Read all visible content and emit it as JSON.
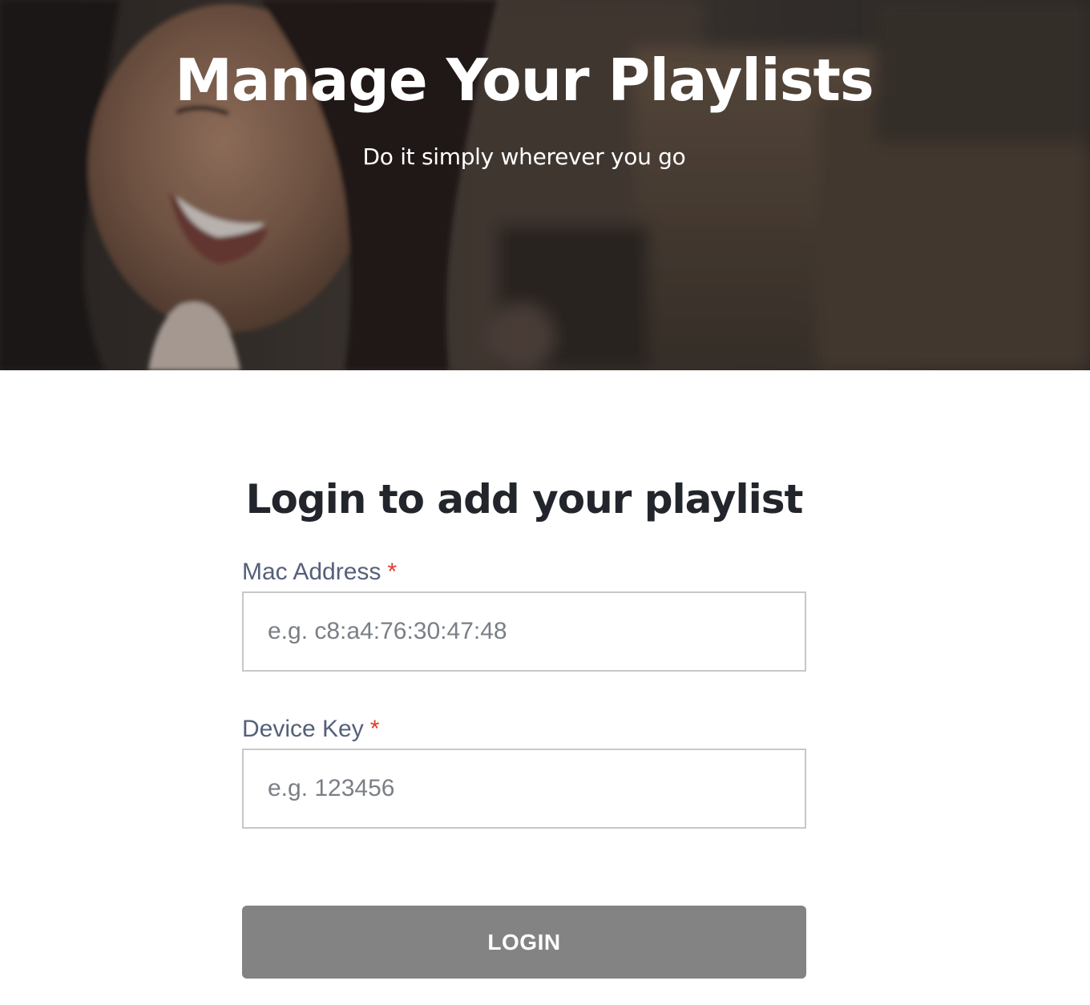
{
  "hero": {
    "title": "Manage Your Playlists",
    "subtitle": "Do it simply wherever you go"
  },
  "login": {
    "title": "Login to add your playlist",
    "mac_label": "Mac Address",
    "mac_required": "*",
    "mac_placeholder": "e.g. c8:a4:76:30:47:48",
    "key_label": "Device Key",
    "key_required": "*",
    "key_placeholder": "e.g. 123456",
    "button_label": "LOGIN"
  },
  "colors": {
    "required": "#e03b2f",
    "button_background": "#838383",
    "label_text": "#55607a",
    "title_text": "#22252b"
  }
}
